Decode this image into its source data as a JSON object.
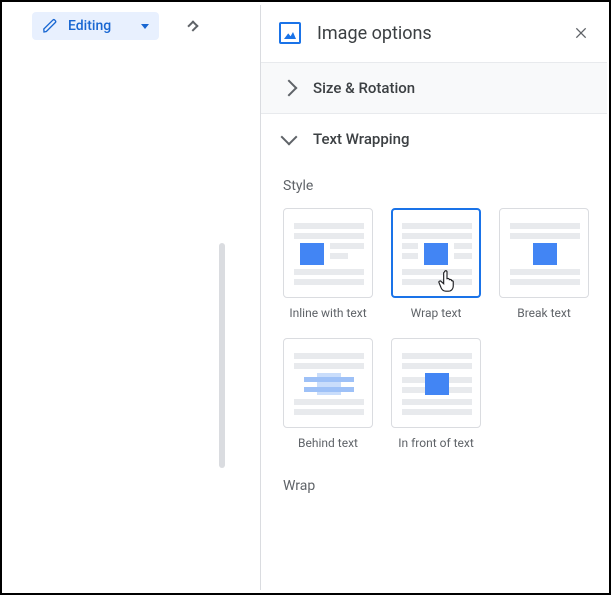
{
  "mode": {
    "label": "Editing"
  },
  "panel": {
    "title": "Image options"
  },
  "sections": {
    "size_rotation": "Size & Rotation",
    "text_wrapping": "Text Wrapping"
  },
  "style": {
    "heading": "Style",
    "options": {
      "inline": "Inline with text",
      "wrap": "Wrap text",
      "break": "Break text",
      "behind": "Behind text",
      "front": "In front of text"
    }
  },
  "wrap": {
    "heading": "Wrap"
  }
}
